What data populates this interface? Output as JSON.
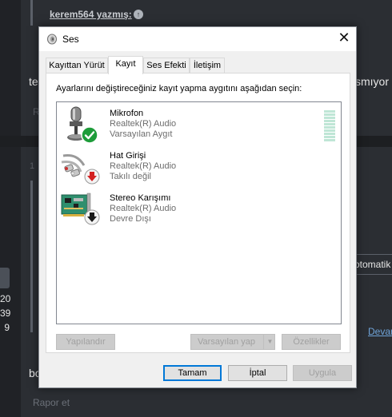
{
  "background": {
    "quote_author": "kerem564 yazmış:",
    "text_left": "te",
    "text_right": "smıyor",
    "faint_r": "R",
    "faint_1": "1",
    "stats": [
      "20",
      "39",
      "9"
    ],
    "otomatik_label": "otomatik",
    "devam_link": "Devan",
    "text_bottom": "bo",
    "rapor_link": "Rapor et"
  },
  "dialog": {
    "title": "Ses",
    "close_glyph": "✕",
    "tabs": [
      {
        "label": "Kayıttan Yürüt"
      },
      {
        "label": "Kayıt"
      },
      {
        "label": "Ses Efekti"
      },
      {
        "label": "İletişim"
      }
    ],
    "active_tab": "Kayıt",
    "instruction": "Ayarlarını değiştireceğiniz kayıt yapma aygıtını aşağıdan seçin:",
    "devices": [
      {
        "name": "Mikrofon",
        "driver": "Realtek(R) Audio",
        "status": "Varsayılan Aygıt",
        "icon": "microphone-icon",
        "badge": "check-badge-icon"
      },
      {
        "name": "Hat Girişi",
        "driver": "Realtek(R) Audio",
        "status": "Takılı değil",
        "icon": "line-in-cable-icon",
        "badge": "red-down-arrow-badge-icon"
      },
      {
        "name": "Stereo Karışımı",
        "driver": "Realtek(R) Audio",
        "status": "Devre Dışı",
        "icon": "sound-card-icon",
        "badge": "black-down-arrow-badge-icon"
      }
    ],
    "buttons": {
      "configure": "Yapılandır",
      "set_default": "Varsayılan yap",
      "properties": "Özellikler",
      "ok": "Tamam",
      "cancel": "İptal",
      "apply": "Uygula"
    }
  },
  "colors": {
    "accent": "#0078d7",
    "check_green": "#1e9c3a",
    "arrow_red": "#d32020",
    "meter": "#bfe6d6"
  }
}
